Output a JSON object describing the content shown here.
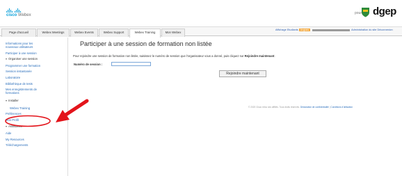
{
  "header": {
    "brand_top": "cisco",
    "brand_product": "Webex",
    "pour": "pour",
    "org_logo": "dgep"
  },
  "tabs": [
    {
      "label": "Page d'accueil"
    },
    {
      "label": "Webex Meetings"
    },
    {
      "label": "Webex Events"
    },
    {
      "label": "Webex Support"
    },
    {
      "label": "Webex Training",
      "active": true
    },
    {
      "label": "Mon Webex"
    }
  ],
  "topbar": {
    "display_label": "Affichage Etudiants",
    "badge": "Anglais",
    "admin_link": "Administration du site",
    "logout_link": "Déconnexion"
  },
  "sidebar": {
    "items": [
      {
        "label": "Informations pour les",
        "type": "link"
      },
      {
        "label": "nouveaux utilisateurs",
        "type": "link"
      },
      {
        "label": "Participer à une session",
        "type": "link"
      },
      {
        "label": "Organiser une session",
        "type": "section"
      },
      {
        "label": "Programmer une formation",
        "type": "link"
      },
      {
        "label": "Session instantanée",
        "type": "link"
      },
      {
        "label": "Laboratoire",
        "type": "link"
      },
      {
        "label": "Bibliothèque de tests",
        "type": "link"
      },
      {
        "label": "Mes enregistrements de",
        "type": "link"
      },
      {
        "label": "formations",
        "type": "link"
      },
      {
        "label": "Installer",
        "type": "section"
      },
      {
        "label": "Webex Training",
        "type": "current"
      },
      {
        "label": "Préférences",
        "type": "link"
      },
      {
        "label": "Mon Profil",
        "type": "link"
      },
      {
        "label": "Assistance",
        "type": "section"
      },
      {
        "label": "Aide",
        "type": "link"
      },
      {
        "label": "My Resources",
        "type": "link"
      },
      {
        "label": "Téléchargements",
        "type": "link"
      }
    ]
  },
  "main": {
    "title": "Participer à une session de formation non listée",
    "desc_prefix": "Pour rejoindre une session de formation non listée, saisissez le numéro de session que l'organisateur vous a donné, puis cliquez sur",
    "desc_bold": "Rejoindre maintenant",
    "session_label": "Numéro de session :",
    "session_value": "",
    "join_button": "Rejoindre maintenant"
  },
  "footer": {
    "copyright": "© 2020 Cisco et/ou ses affiliés. Tous droits réservés.",
    "privacy": "Déclaration de confidentialité",
    "sep": "|",
    "terms": "Conditions d'utilisation"
  },
  "colors": {
    "cisco_blue": "#049fd9",
    "link_blue": "#2a6ebb",
    "annotation_red": "#e3141b",
    "dgep_green": "#2e8b3a"
  }
}
